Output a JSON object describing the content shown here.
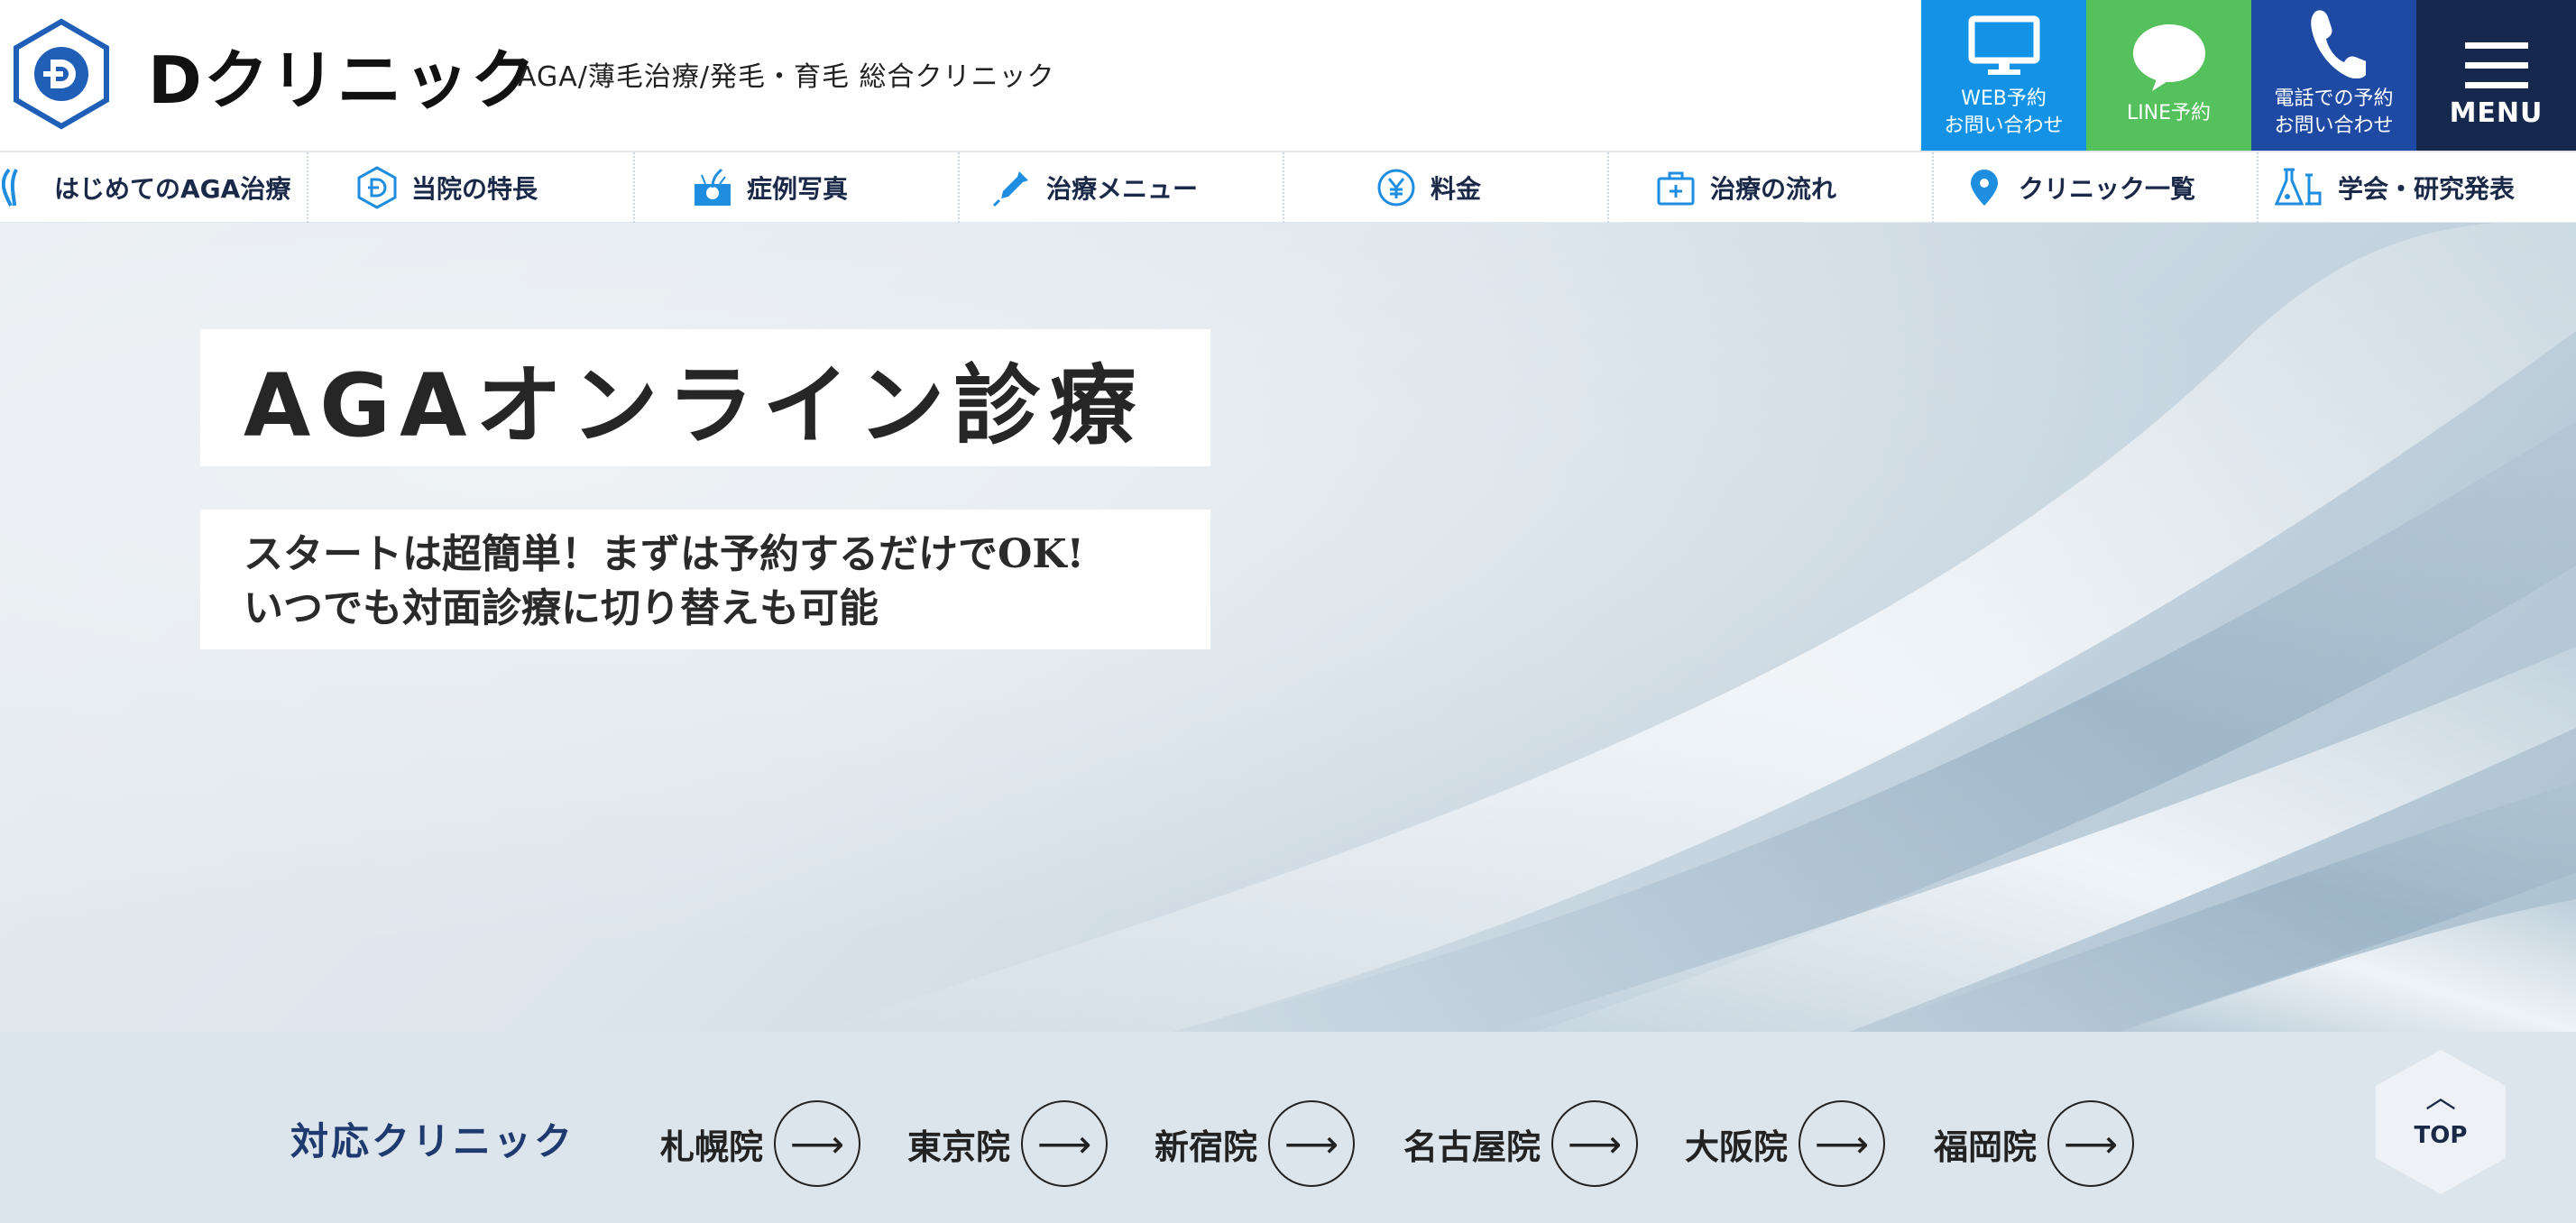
{
  "header": {
    "logo_text": "Dクリニック",
    "tagline": "AGA/薄毛治療/発毛・育毛 総合クリニック",
    "cta_web": "WEB予約\nお問い合わせ",
    "cta_line": "LINE予約",
    "cta_tel": "電話での予約\nお問い合わせ",
    "cta_menu": "MENU"
  },
  "nav": {
    "items": [
      {
        "label": "はじめてのAGA治療",
        "icon": "hair-strand-icon"
      },
      {
        "label": "当院の特長",
        "icon": "clinic-logo-icon"
      },
      {
        "label": "症例写真",
        "icon": "hair-follicle-icon"
      },
      {
        "label": "治療メニュー",
        "icon": "dropper-icon"
      },
      {
        "label": "料金",
        "icon": "yen-icon"
      },
      {
        "label": "治療の流れ",
        "icon": "medical-kit-icon"
      },
      {
        "label": "クリニック一覧",
        "icon": "map-pin-icon"
      },
      {
        "label": "学会・研究発表",
        "icon": "flask-icon"
      }
    ]
  },
  "hero": {
    "title": "AGAオンライン診療",
    "subtitle_line1": "スタートは超簡単！まずは予約するだけでOK!",
    "subtitle_line2": "いつでも対面診療に切り替えも可能"
  },
  "clinics": {
    "label": "対応クリニック",
    "items": [
      "札幌院",
      "東京院",
      "新宿院",
      "名古屋院",
      "大阪院",
      "福岡院"
    ],
    "arrow": "⟶"
  },
  "top_button": {
    "caret": "︿",
    "label": "TOP"
  },
  "colors": {
    "web": "#1493e6",
    "line": "#55c15c",
    "tel": "#1e4aa3",
    "menu": "#17284f",
    "accent": "#1f8ee0"
  }
}
